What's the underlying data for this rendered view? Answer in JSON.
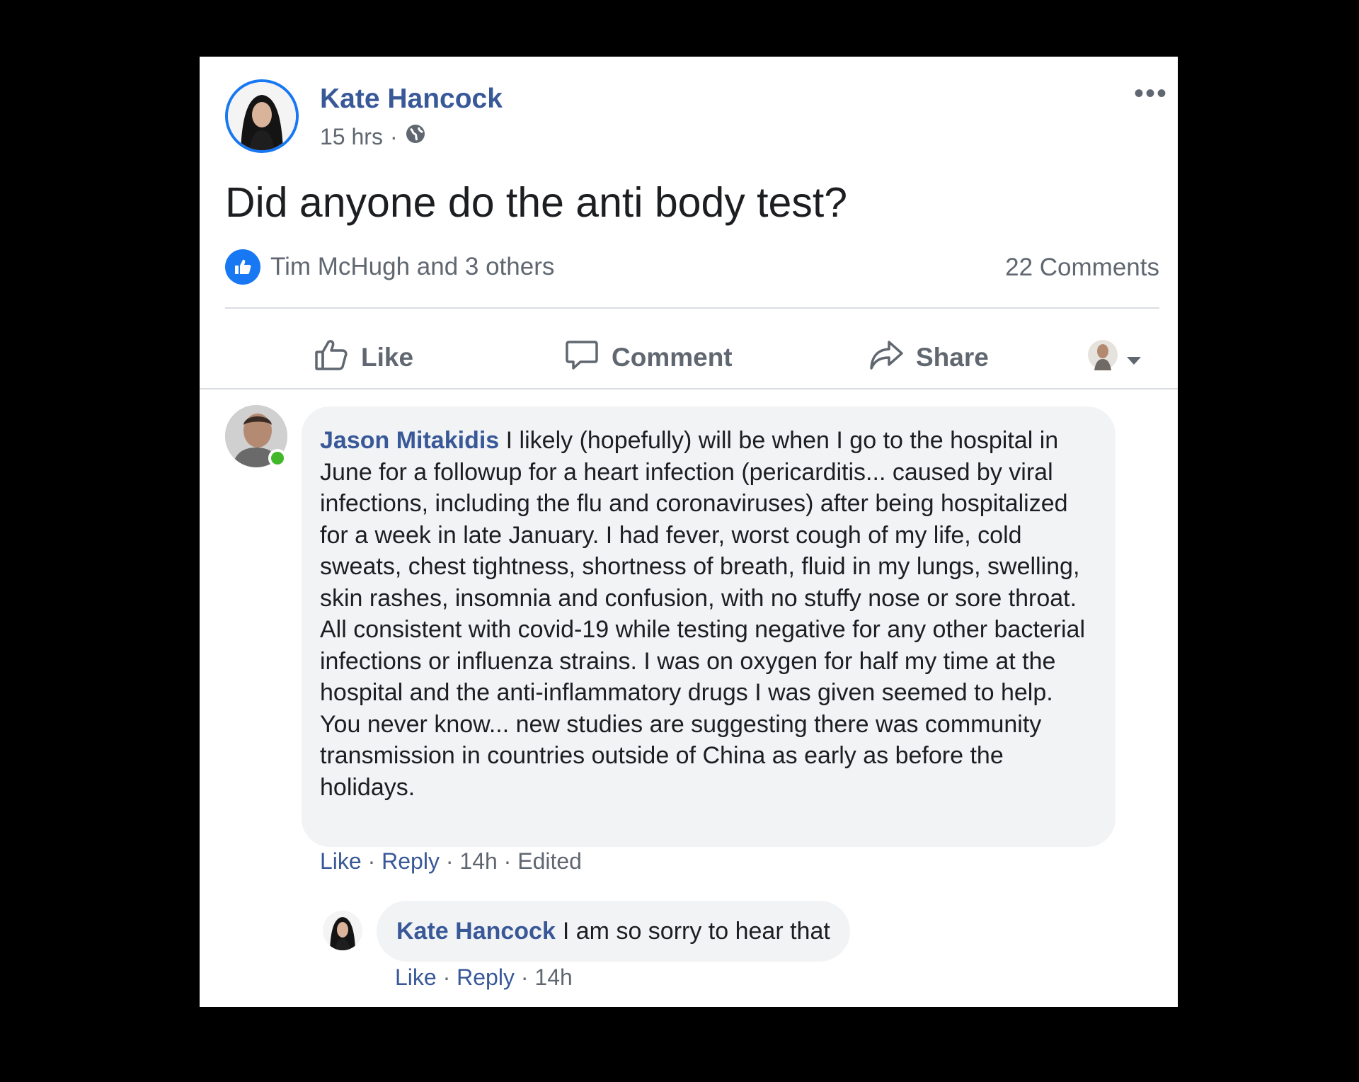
{
  "post": {
    "author": "Kate Hancock",
    "time": "15 hrs",
    "separator": "·",
    "text": "Did anyone do the anti body test?",
    "reactions_text": "Tim McHugh and 3 others",
    "comments_count": "22 Comments"
  },
  "actions": {
    "like": "Like",
    "comment": "Comment",
    "share": "Share"
  },
  "comments": [
    {
      "author": "Jason Mitakidis",
      "text": "I likely (hopefully) will be when I go to the hospital in June for a followup for a heart infection (pericarditis... caused by viral infections, including the flu and coronaviruses) after being hospitalized for a week in late January. I had fever, worst cough of my life, cold sweats, chest tightness, shortness of breath, fluid in my lungs, swelling, skin rashes, insomnia and confusion, with no stuffy nose or sore throat. All consistent with covid-19 while testing negative for any other bacterial infections or influenza strains. I was on oxygen for half my time at the hospital and the anti-inflammatory drugs I was given seemed to help. You never know... new studies are suggesting there was community transmission in countries outside of China as early as before the holidays.",
      "like": "Like",
      "reply": "Reply",
      "time": "14h",
      "edited": "Edited"
    }
  ],
  "reply": {
    "author": "Kate Hancock",
    "text": "I am so sorry to hear that",
    "like": "Like",
    "reply": "Reply",
    "time": "14h"
  },
  "colors": {
    "name_blue": "#385898",
    "fb_blue": "#1877f2",
    "muted": "#606770",
    "bubble_bg": "#f2f3f5"
  }
}
